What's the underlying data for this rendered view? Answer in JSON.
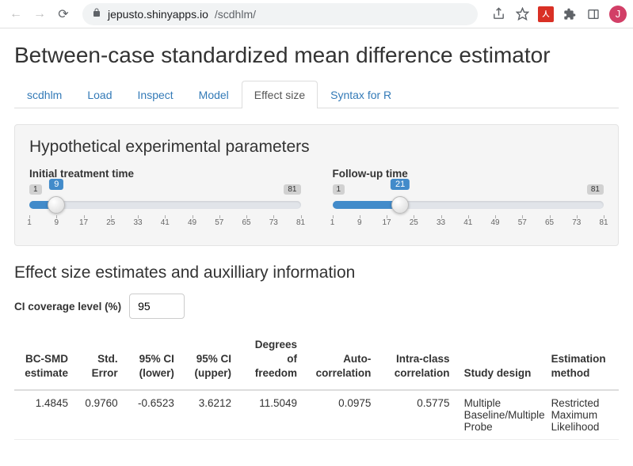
{
  "browser": {
    "url_host": "jepusto.shinyapps.io",
    "url_path": "/scdhlm/",
    "avatar_initial": "J",
    "pdf_label": "▶"
  },
  "page": {
    "title": "Between-case standardized mean difference estimator"
  },
  "tabs": [
    {
      "label": "scdhlm",
      "active": false
    },
    {
      "label": "Load",
      "active": false
    },
    {
      "label": "Inspect",
      "active": false
    },
    {
      "label": "Model",
      "active": false
    },
    {
      "label": "Effect size",
      "active": true
    },
    {
      "label": "Syntax for R",
      "active": false
    }
  ],
  "well": {
    "heading": "Hypothetical experimental parameters",
    "sliders": {
      "initial": {
        "label": "Initial treatment time",
        "min": 1,
        "max": 81,
        "value": 9,
        "pct": 10,
        "ticks": [
          "1",
          "9",
          "17",
          "25",
          "33",
          "41",
          "49",
          "57",
          "65",
          "73",
          "81"
        ]
      },
      "followup": {
        "label": "Follow-up time",
        "min": 1,
        "max": 81,
        "value": 21,
        "pct": 25,
        "ticks": [
          "1",
          "9",
          "17",
          "25",
          "33",
          "41",
          "49",
          "57",
          "65",
          "73",
          "81"
        ]
      }
    }
  },
  "effect_section": {
    "heading": "Effect size estimates and auxilliary information",
    "ci_label": "CI coverage level (%)",
    "ci_value": "95"
  },
  "table": {
    "headers": [
      "BC-SMD estimate",
      "Std. Error",
      "95% CI (lower)",
      "95% CI (upper)",
      "Degrees of freedom",
      "Auto-correlation",
      "Intra-class correlation",
      "Study design",
      "Estimation method"
    ],
    "row": {
      "bcsmd": "1.4845",
      "se": "0.9760",
      "ci_lo": "-0.6523",
      "ci_hi": "3.6212",
      "df": "11.5049",
      "autocorr": "0.0975",
      "icc": "0.5775",
      "design": "Multiple Baseline/Multiple Probe",
      "method": "Restricted Maximum Likelihood"
    }
  }
}
